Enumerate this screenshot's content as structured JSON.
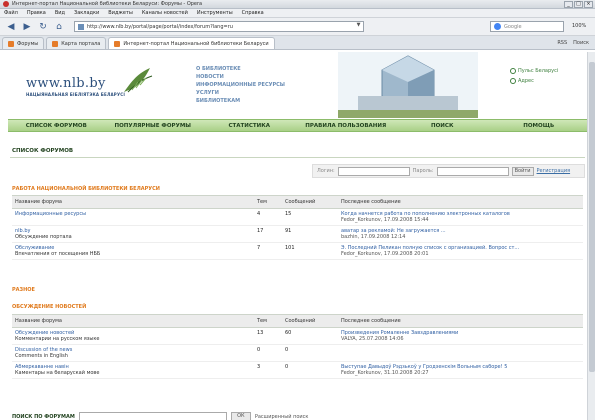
{
  "window": {
    "title": "Интернет-портал Национальной библиотеки Беларуси: Форумы - Opera"
  },
  "menu": [
    "Файл",
    "Правка",
    "Вид",
    "Закладки",
    "Виджеты",
    "Каналы новостей",
    "Инструменты",
    "Справка"
  ],
  "address": {
    "url": "http://www.nlb.by/portal/page/portal/index/forum?lang=ru",
    "search_placeholder": "Google",
    "zoom": "100%"
  },
  "tabs": [
    {
      "label": "Форумы"
    },
    {
      "label": "Карта портала"
    },
    {
      "label": "Интернет-портал Национальной библиотеки Беларуси"
    }
  ],
  "tabbar_right": [
    "RSS",
    "Поиск"
  ],
  "site": {
    "logo": "www.nlb.by",
    "logo_sub": "НАЦЫЯНАЛЬНАЯ БІБЛІЯТЭКА БЕЛАРУСІ",
    "topics": [
      "О БИБЛИОТЕКЕ",
      "НОВОСТИ",
      "ИНФОРМАЦИОННЫЕ РЕСУРСЫ",
      "УСЛУГИ",
      "БИБЛИОТЕКАМ"
    ],
    "right_links": [
      "Пульс Беларусі",
      "Адрес"
    ]
  },
  "nav": [
    "СПИСОК ФОРУМОВ",
    "ПОПУЛЯРНЫЕ ФОРУМЫ",
    "СТАТИСТИКА",
    "ПРАВИЛА ПОЛЬЗОВАНИЯ",
    "ПОИСК",
    "ПОМОЩЬ"
  ],
  "page_title": "СПИСОК ФОРУМОВ",
  "login": {
    "login_label": "Логин:",
    "password_label": "Пароль:",
    "button": "Войти",
    "register": "Регистрация"
  },
  "columns": {
    "name": "Название форума",
    "topics": "Тем",
    "messages": "Сообщений",
    "last": "Последнее сообщение"
  },
  "categories": [
    {
      "title": "РАБОТА НАЦИОНАЛЬНОЙ БИБЛИОТЕКИ БЕЛАРУСИ",
      "forums": [
        {
          "name": "Информационные ресурсы",
          "desc": "",
          "topics": "4",
          "messages": "15",
          "last": "Когда начнется работа по пополнению электронных каталогов",
          "author": "Fedor_Korkunov, 17.09.2008 15:44"
        },
        {
          "name": "nlb.by",
          "desc": "Обсуждение портала",
          "topics": "17",
          "messages": "91",
          "last": "аватар за рекламой: Не загружается ...",
          "author": "bazhin, 17.09.2008 12:14"
        },
        {
          "name": "Обслуживание",
          "desc": "Впечатления от посещения НББ",
          "topics": "7",
          "messages": "101",
          "last": "Э. Последний Пеликан полную список с организацией. Вопрос ст...",
          "author": "Fedor_Korkunov, 17.09.2008 20:01"
        }
      ]
    },
    {
      "title": "РАЗНОЕ",
      "forums": []
    },
    {
      "title": "ОБСУЖДЕНИЕ НОВОСТЕЙ",
      "forums": [
        {
          "name": "Обсуждение новостей",
          "desc": "Комментарии на русском языке",
          "topics": "13",
          "messages": "60",
          "last": "Произведения Ромаленне Завздравлениями",
          "author": "VALYA, 25.07.2008 14:06"
        },
        {
          "name": "Discussion of the news",
          "desc": "Comments in English",
          "topics": "0",
          "messages": "0",
          "last": "",
          "author": ""
        },
        {
          "name": "Абмеркаванне навін",
          "desc": "Каментары на беларускай мове",
          "topics": "3",
          "messages": "0",
          "last": "Выступае Давыдоў Рэдзькоў у Гродзенскім Вольным саборе! 5",
          "author": "Fedor_Korkunov, 31.10.2008 20:27"
        }
      ]
    }
  ],
  "search": {
    "label": "ПОИСК ПО ФОРУМАМ",
    "button": "ОК",
    "advanced": "Расширенный поиск"
  }
}
